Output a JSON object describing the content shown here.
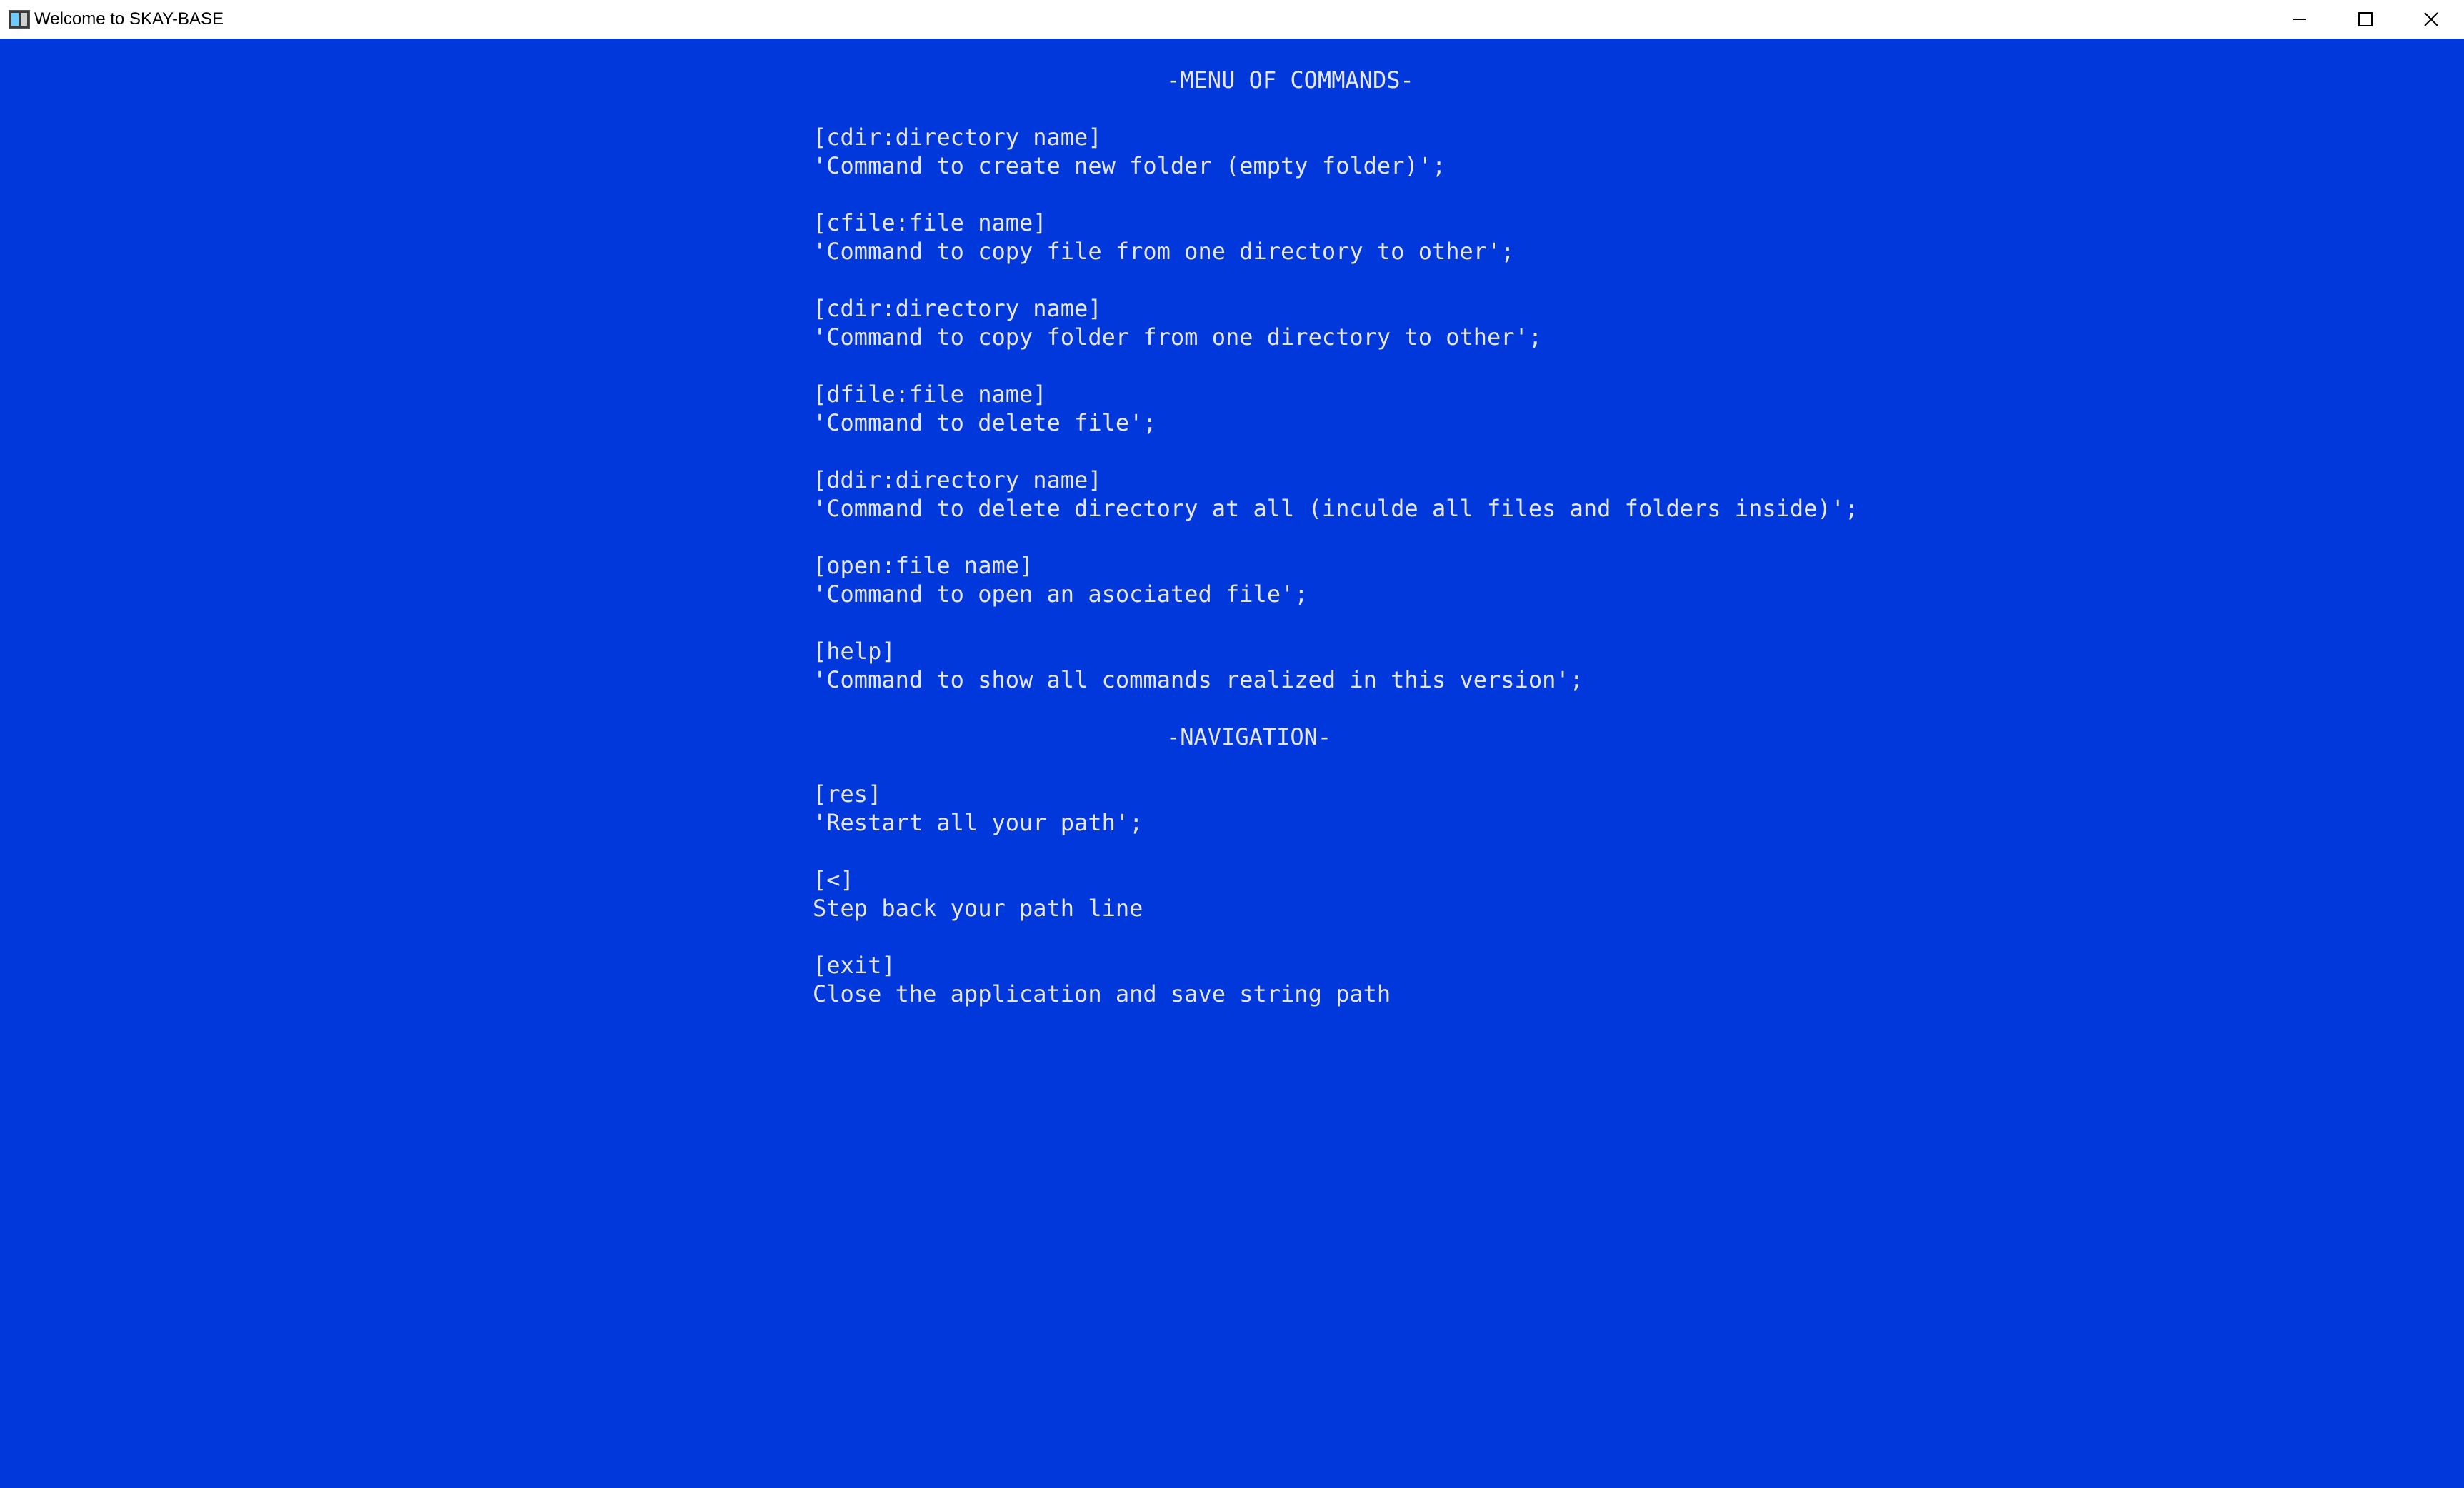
{
  "window": {
    "title": "Welcome to SKAY-BASE",
    "icon": "console-app-icon",
    "controls": [
      "minimize-icon",
      "maximize-icon",
      "close-icon"
    ]
  },
  "colors": {
    "background": "#0038DC",
    "text": "#E6E6E6"
  },
  "console": {
    "menu_header": "-MENU OF COMMANDS-",
    "commands": [
      {
        "syntax": "[cdir:directory name]",
        "description": "'Command to create new folder (empty folder)';"
      },
      {
        "syntax": "[cfile:file name]",
        "description": "'Command to copy file from one directory to other';"
      },
      {
        "syntax": "[cdir:directory name]",
        "description": "'Command to copy folder from one directory to other';"
      },
      {
        "syntax": "[dfile:file name]",
        "description": "'Command to delete file';"
      },
      {
        "syntax": "[ddir:directory name]",
        "description": "'Command to delete directory at all (inculde all files and folders inside)';"
      },
      {
        "syntax": "[open:file name]",
        "description": "'Command to open an asociated file';"
      },
      {
        "syntax": "[help]",
        "description": "'Command to show all commands realized in this version';"
      }
    ],
    "navigation_header": "-NAVIGATION-",
    "navigation": [
      {
        "syntax": "[res]",
        "description": "'Restart all your path';"
      },
      {
        "syntax": "[<]",
        "description": "Step back your path line"
      },
      {
        "syntax": "[exit]",
        "description": "Close the application and save string path"
      }
    ]
  }
}
